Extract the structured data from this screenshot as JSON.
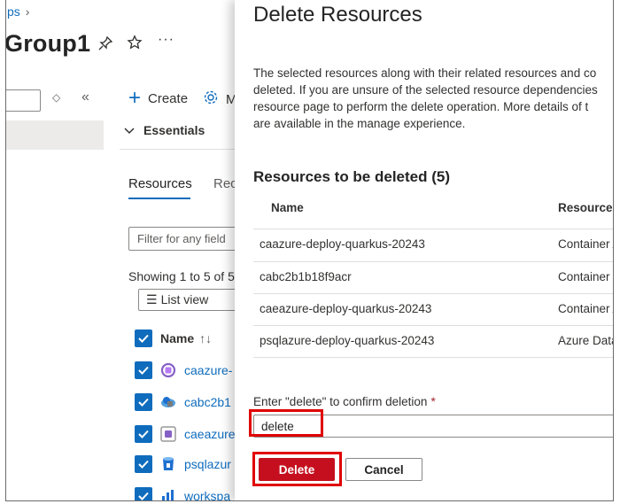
{
  "background": {
    "breadcrumb": "ps",
    "title": "Group1",
    "toolbar": {
      "create_label": "Create",
      "manage_label": "M"
    },
    "essentials_label": "Essentials",
    "tabs": {
      "resources": "Resources",
      "recommendations": "Rec"
    },
    "filter_placeholder": "Filter for any field",
    "showing_text": "Showing 1 to 5 of 5",
    "list_view_label": "List view",
    "name_header": "Name",
    "rows": [
      {
        "name": "caazure-",
        "icon": "container-app-icon"
      },
      {
        "name": "cabc2b1",
        "icon": "container-registry-icon"
      },
      {
        "name": "caeazure",
        "icon": "container-app-environment-icon"
      },
      {
        "name": "psqlazur",
        "icon": "postgresql-icon"
      },
      {
        "name": "workspa",
        "icon": "log-analytics-icon"
      }
    ]
  },
  "panel": {
    "title": "Delete Resources",
    "description": [
      "The selected resources along with their related resources and co",
      "deleted. If you are unsure of the selected resource dependencies",
      "resource page to perform the delete operation. More details of t",
      "are available in the manage experience."
    ],
    "subtitle": "Resources to be deleted (5)",
    "columns": {
      "name": "Name",
      "type": "Resource t"
    },
    "resources": [
      {
        "name": "caazure-deploy-quarkus-20243",
        "type": "Container A"
      },
      {
        "name": "cabc2b1b18f9acr",
        "type": "Container r"
      },
      {
        "name": "caeazure-deploy-quarkus-20243",
        "type": "Container A"
      },
      {
        "name": "psqlazure-deploy-quarkus-20243",
        "type": "Azure Data"
      }
    ],
    "confirm_label": "Enter \"delete\" to confirm deletion",
    "required_mark": "*",
    "confirm_value": "delete",
    "delete_button": "Delete",
    "cancel_button": "Cancel"
  },
  "colors": {
    "accent": "#0f6cbd",
    "danger": "#c50f1f",
    "highlight": "#e00000"
  }
}
